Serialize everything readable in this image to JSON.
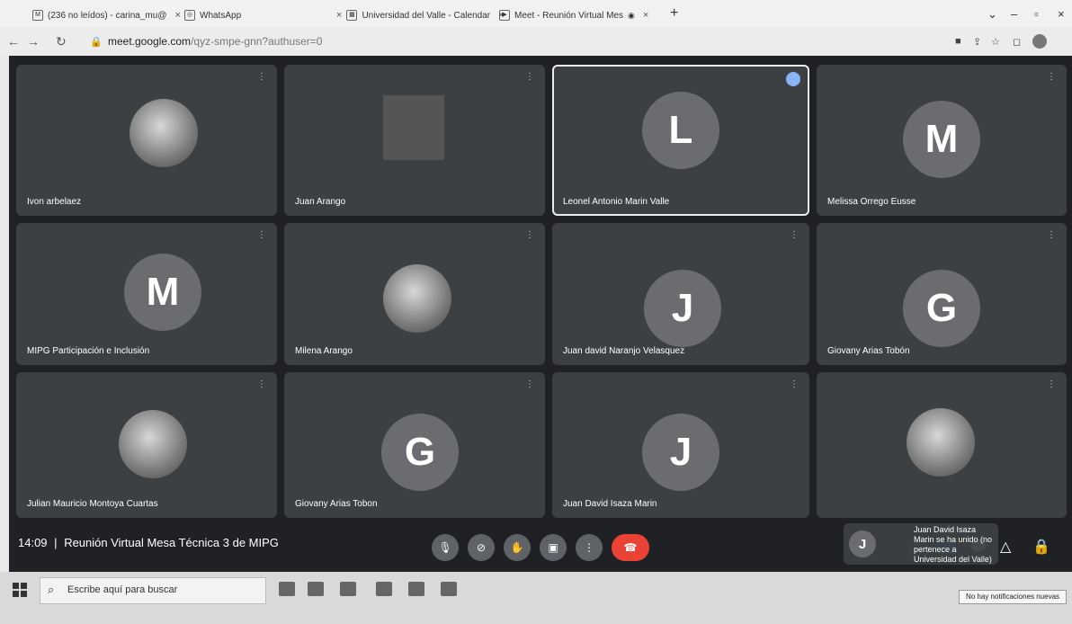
{
  "browser": {
    "tabs": [
      {
        "label": "(236 no leídos) - carina_mu@",
        "close": "×"
      },
      {
        "label": "WhatsApp",
        "close": "×"
      },
      {
        "label": "Universidad del Valle - Calendar",
        "close": "×"
      },
      {
        "label": "Meet - Reunión Virtual Mes",
        "close": "×"
      }
    ],
    "new_tab": "+",
    "url_host": "meet.google.com",
    "url_path": "/qyz-smpe-gnn?authuser=0",
    "window_controls": {
      "minimize": "–",
      "maximize": "▫",
      "close": "×",
      "chevron": "⌄"
    }
  },
  "meet": {
    "participants": [
      {
        "name": "Ivon arbelaez",
        "type": "photo"
      },
      {
        "name": "Juan Arango",
        "type": "photo"
      },
      {
        "name": "Leonel Antonio Marin Valle",
        "type": "letter",
        "initial": "L",
        "active": true
      },
      {
        "name": "Melissa Orrego Eusse",
        "type": "letter",
        "initial": "M"
      },
      {
        "name": "MIPG Participación e Inclusión",
        "type": "letter",
        "initial": "M"
      },
      {
        "name": "Milena Arango",
        "type": "photo"
      },
      {
        "name": "Juan david Naranjo Velasquez",
        "type": "letter",
        "initial": "J"
      },
      {
        "name": "Giovany Arias Tobón",
        "type": "letter",
        "initial": "G"
      },
      {
        "name": "Julian Mauricio Montoya Cuartas",
        "type": "photo"
      },
      {
        "name": "Giovany Arias Tobon",
        "type": "letter",
        "initial": "G"
      },
      {
        "name": "Juan David Isaza Marin",
        "type": "letter",
        "initial": "J"
      },
      {
        "name": "",
        "type": "photo"
      }
    ],
    "time": "14:09",
    "meeting_title": "Reunión Virtual Mesa Técnica 3 de MIPG",
    "notification": {
      "initial": "J",
      "text": "Juan David Isaza Marin se ha unido (no pertenece a Universidad del Valle)"
    }
  },
  "taskbar": {
    "search_placeholder": "Escribe aquí para buscar",
    "toast": "No hay notificaciones nuevas"
  }
}
